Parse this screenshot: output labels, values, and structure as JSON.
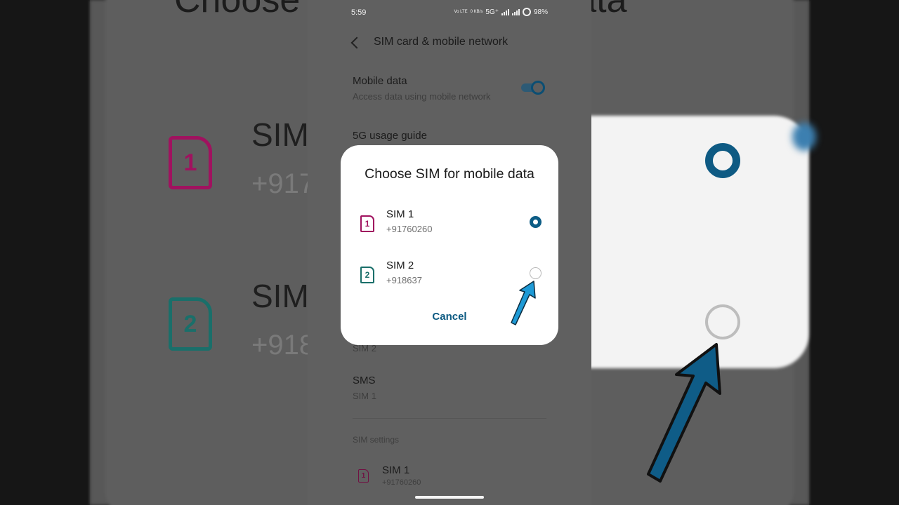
{
  "status_bar": {
    "time": "5:59",
    "volte1": "Vo LTE",
    "speed": "0 KB/s",
    "network": "5G⁺",
    "battery": "98%"
  },
  "app_bar": {
    "title": "SIM card & mobile network"
  },
  "settings": {
    "mobile_data_title": "Mobile data",
    "mobile_data_sub": "Access data using mobile network",
    "mobile_data_enabled": true,
    "usage_guide": "5G usage guide",
    "calls_sub": "SIM 2",
    "sms_title": "SMS",
    "sms_sub": "SIM 1",
    "sim_settings_label": "SIM settings",
    "sim1_title": "SIM 1",
    "sim1_number": "+91760260"
  },
  "dialog": {
    "title": "Choose SIM for mobile data",
    "options": [
      {
        "label": "SIM 1",
        "number": "+91760260",
        "icon_digit": "1",
        "selected": true,
        "color": "#a0125f"
      },
      {
        "label": "SIM 2",
        "number": "+918637",
        "icon_digit": "2",
        "selected": false,
        "color": "#1a6f6a"
      }
    ],
    "cancel_label": "Cancel"
  },
  "background_zoom": {
    "title": "Choose SIM for mobile data",
    "sim1_label": "SIM",
    "sim1_number": "+917",
    "sim2_label": "SIM",
    "sim2_number": "+918"
  },
  "colors": {
    "accent": "#0d5d86",
    "sim1": "#a0125f",
    "sim2": "#1a6f6a",
    "annotation_arrow": "#1e9ad6"
  }
}
